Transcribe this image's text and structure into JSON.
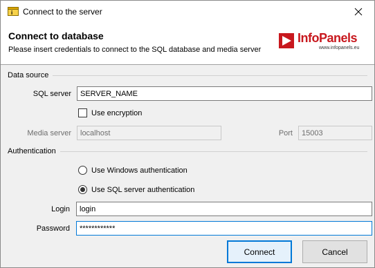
{
  "window": {
    "title": "Connect to the server"
  },
  "header": {
    "title": "Connect to database",
    "subtitle": "Please insert credentials to connect to the SQL database and media server",
    "logo_info": "Info",
    "logo_panels": "Panels",
    "logo_url": "www.infopanels.eu"
  },
  "data_source": {
    "group_label": "Data source",
    "sql_server_label": "SQL server",
    "sql_server_value": "SERVER_NAME",
    "use_encryption_label": "Use encryption",
    "use_encryption_checked": false,
    "media_server_label": "Media server",
    "media_server_value": "localhost",
    "port_label": "Port",
    "port_value": "15003"
  },
  "authentication": {
    "group_label": "Authentication",
    "windows_auth_label": "Use Windows authentication",
    "sql_auth_label": "Use SQL server authentication",
    "selected": "sql",
    "login_label": "Login",
    "login_value": "login",
    "password_label": "Password",
    "password_value": "************"
  },
  "buttons": {
    "connect": "Connect",
    "cancel": "Cancel"
  },
  "colors": {
    "accent": "#0078d7",
    "brand_red": "#c8181e"
  }
}
